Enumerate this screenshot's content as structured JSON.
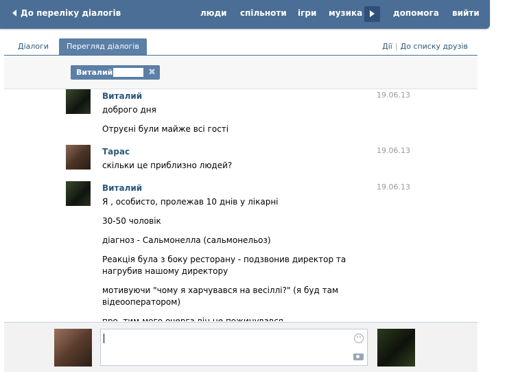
{
  "topbar": {
    "back_label": "До переліку діалогів",
    "nav": {
      "people": "люди",
      "communities": "спільноти",
      "games": "ігри",
      "music": "музика",
      "help": "допомога",
      "logout": "вийти"
    }
  },
  "tabs": {
    "dialogs": "Діалоги",
    "view_dialogs": "Перегляд діалогів",
    "actions": "Дії",
    "sep": "|",
    "friends_list": "До списку друзів"
  },
  "recipient": {
    "name": "Виталий"
  },
  "messages": [
    {
      "author": "Виталий",
      "date": "19.06.13",
      "lines": [
        "доброго дня",
        "Отруєні були майже всі гості"
      ]
    },
    {
      "author": "Тарас",
      "date": "19.06.13",
      "lines": [
        "скільки це приблизно людей?"
      ]
    },
    {
      "author": "Виталий",
      "date": "19.06.13",
      "lines": [
        "Я , особисто, пролежав 10 днів у лікарні",
        "30-50 чоловік",
        "діагноз - Сальмонелла (сальмонельоз)",
        "Реакція була з боку ресторану - подзвонив директор та нагрубив нашому директору",
        "мотивуючи \"чому я харчувався на весіллі?\" (я буд там відеооператором)",
        "про, тим мого очерга він не пожинувався"
      ]
    }
  ],
  "compose": {
    "value": ""
  },
  "icons": {
    "back": "back-arrow-icon",
    "more": "chevron-right-icon",
    "remove": "close-icon",
    "emoji": "smile-icon",
    "photo": "camera-icon"
  }
}
